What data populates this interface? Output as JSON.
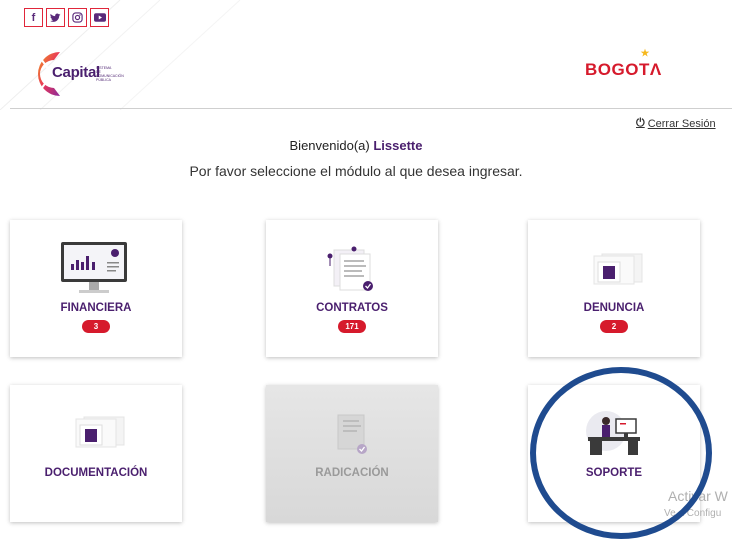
{
  "social": [
    {
      "name": "facebook",
      "glyph": "f"
    },
    {
      "name": "twitter",
      "glyph": "🐦"
    },
    {
      "name": "instagram",
      "glyph": "◎"
    },
    {
      "name": "youtube",
      "glyph": "▶"
    }
  ],
  "brand": {
    "capital": "Capital",
    "capital_sub": "SISTEMA DE COMUNICACIÓN PÚBLICA",
    "bogota": "BOGOTΛ"
  },
  "logout_label": "Cerrar Sesión",
  "welcome": {
    "prefix": "Bienvenido(a) ",
    "user": "Lissette"
  },
  "prompt": "Por favor seleccione el módulo al que desea ingresar.",
  "modules": [
    {
      "label": "FINANCIERA",
      "badge": "3"
    },
    {
      "label": "CONTRATOS",
      "badge": "171"
    },
    {
      "label": "DENUNCIA",
      "badge": "2"
    },
    {
      "label": "DOCUMENTACIÓN"
    },
    {
      "label": "RADICACIÓN",
      "disabled": true
    },
    {
      "label": "SOPORTE"
    }
  ],
  "watermark": {
    "line1": "Activar W",
    "line2": "Ve a Configu"
  },
  "colors": {
    "brand_purple": "#4a1f6e",
    "brand_red": "#d61a2c",
    "annotation_circle": "#1f4b8f"
  }
}
